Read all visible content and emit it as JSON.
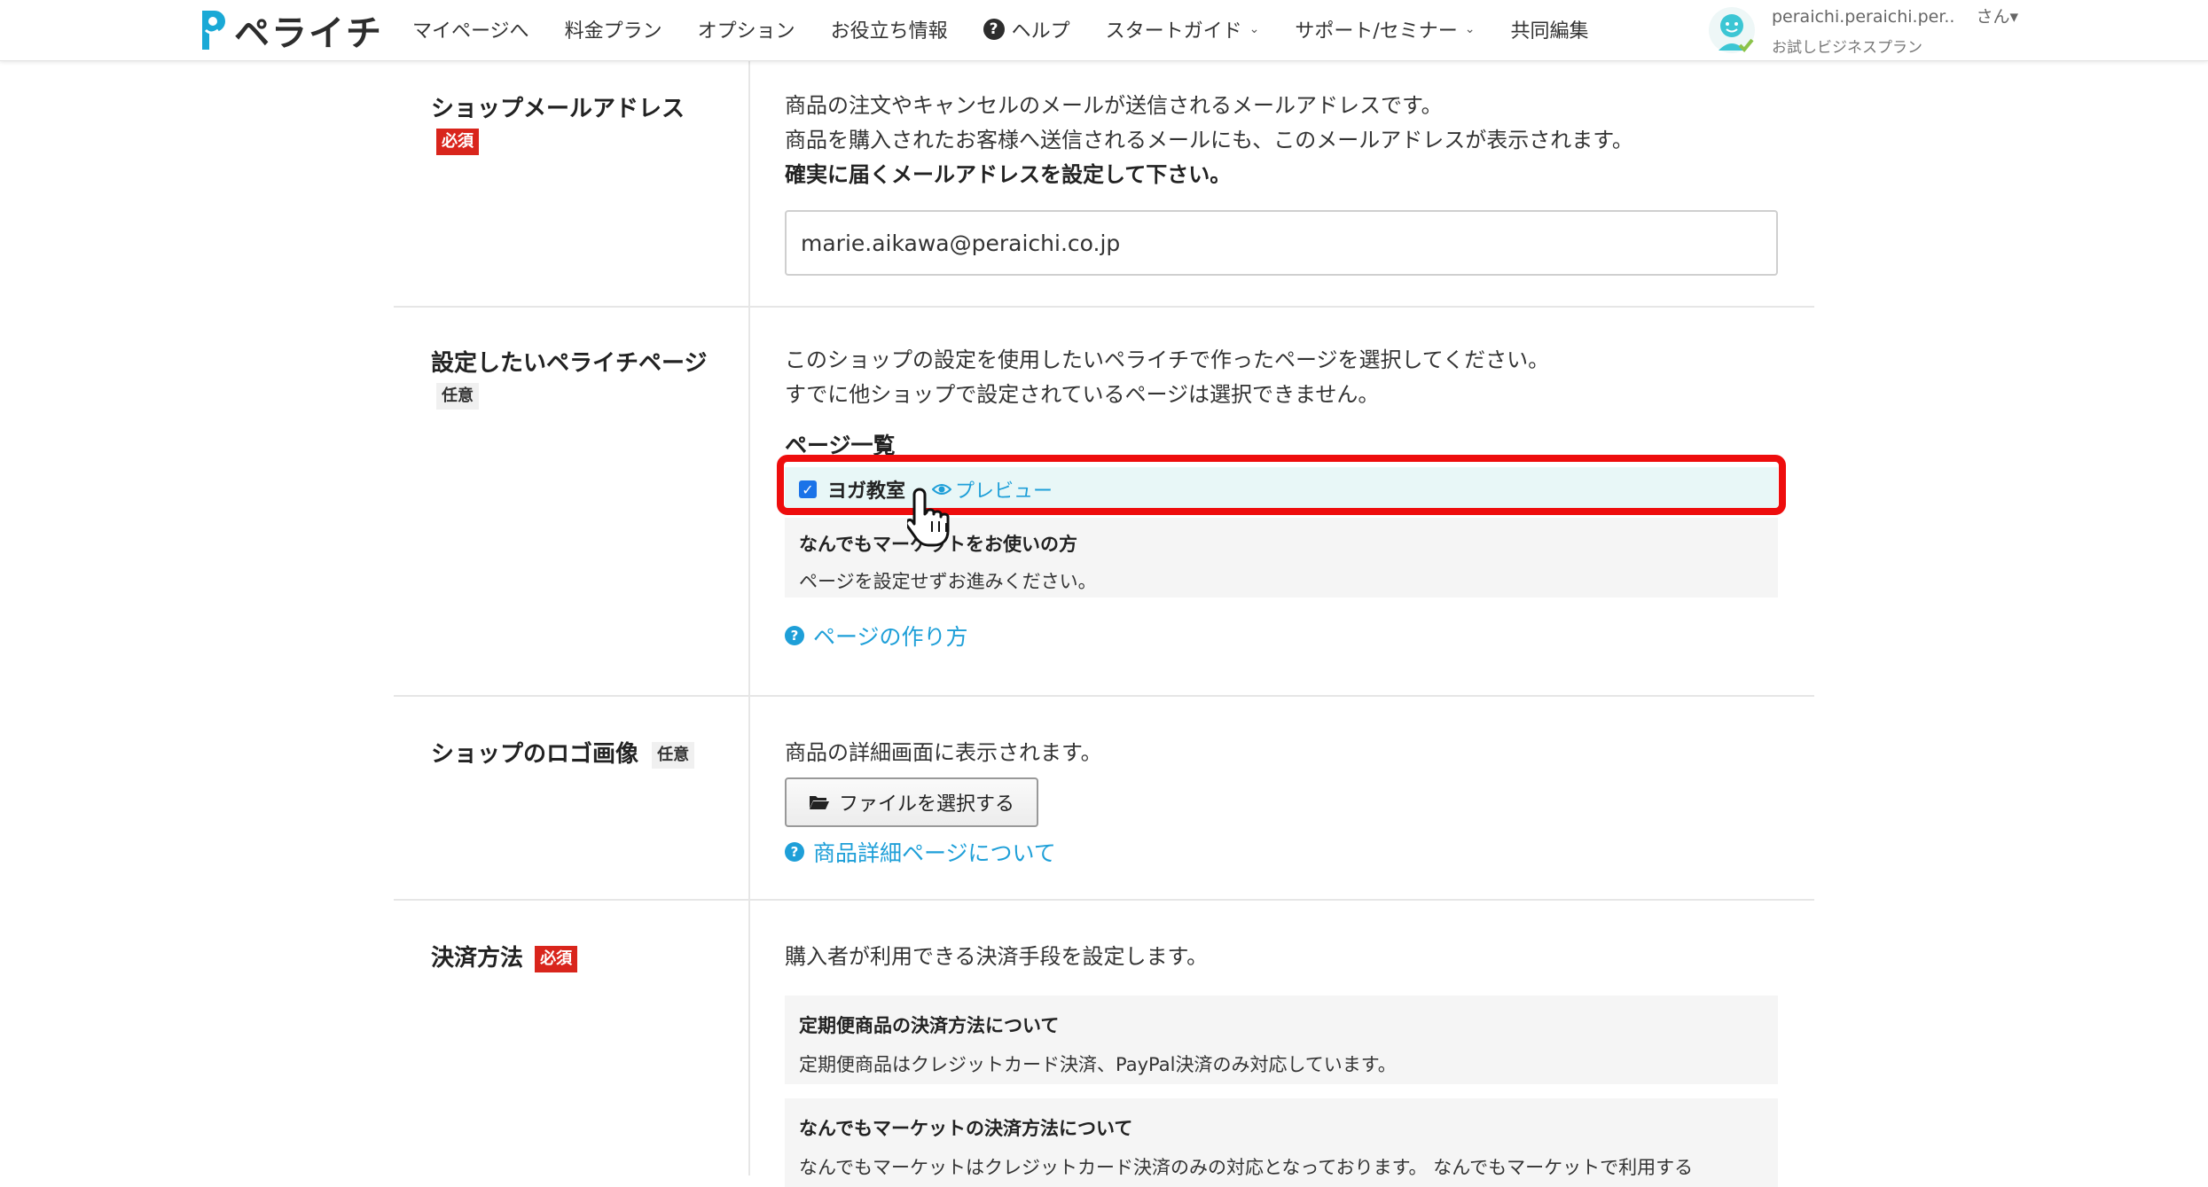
{
  "header": {
    "logo_text": "ペライチ",
    "nav": [
      {
        "label": "マイページへ"
      },
      {
        "label": "料金プラン"
      },
      {
        "label": "オプション"
      },
      {
        "label": "お役立ち情報"
      },
      {
        "label": "ヘルプ",
        "icon": "question-circle-icon"
      },
      {
        "label": "スタートガイド",
        "dropdown": true
      },
      {
        "label": "サポート/セミナー",
        "dropdown": true
      },
      {
        "label": "共同編集"
      }
    ],
    "user": {
      "name": "peraichi.peraichi.per..",
      "suffix": "さん▾",
      "plan": "お試しビジネスプラン"
    }
  },
  "form": {
    "shop_email": {
      "label": "ショップメールアドレス",
      "badge": "必須",
      "desc1": "商品の注文やキャンセルのメールが送信されるメールアドレスです。",
      "desc2": "商品を購入されたお客様へ送信されるメールにも、このメールアドレスが表示されます。",
      "desc_strong": "確実に届くメールアドレスを設定して下さい。",
      "value": "marie.aikawa@peraichi.co.jp"
    },
    "pages": {
      "label": "設定したいペライチページ",
      "badge": "任意",
      "desc1": "このショップの設定を使用したいペライチで作ったページを選択してください。",
      "desc2": "すでに他ショップで設定されているページは選択できません。",
      "list_title": "ページ一覧",
      "items": [
        {
          "name": "ヨガ教室",
          "checked": true,
          "preview_label": "プレビュー"
        }
      ],
      "note_title": "なんでもマーケットをお使いの方",
      "note_body": "ページを設定せずお進みください。",
      "help_link": "ページの作り方"
    },
    "logo": {
      "label": "ショップのロゴ画像",
      "badge": "任意",
      "desc": "商品の詳細画面に表示されます。",
      "button_label": "ファイルを選択する",
      "help_link": "商品詳細ページについて"
    },
    "payment": {
      "label": "決済方法",
      "badge": "必須",
      "desc": "購入者が利用できる決済手段を設定します。",
      "note1_title": "定期便商品の決済方法について",
      "note1_body": "定期便商品はクレジットカード決済、PayPal決済のみ対応しています。",
      "note2_title": "なんでもマーケットの決済方法について",
      "note2_body": "なんでもマーケットはクレジットカード決済のみの対応となっております。 なんでもマーケットで利用する"
    }
  },
  "colors": {
    "required_badge": "#d9251c",
    "link": "#1e9fd8",
    "highlight": "#ee0d0d",
    "selected_row": "#e8f7f7"
  }
}
